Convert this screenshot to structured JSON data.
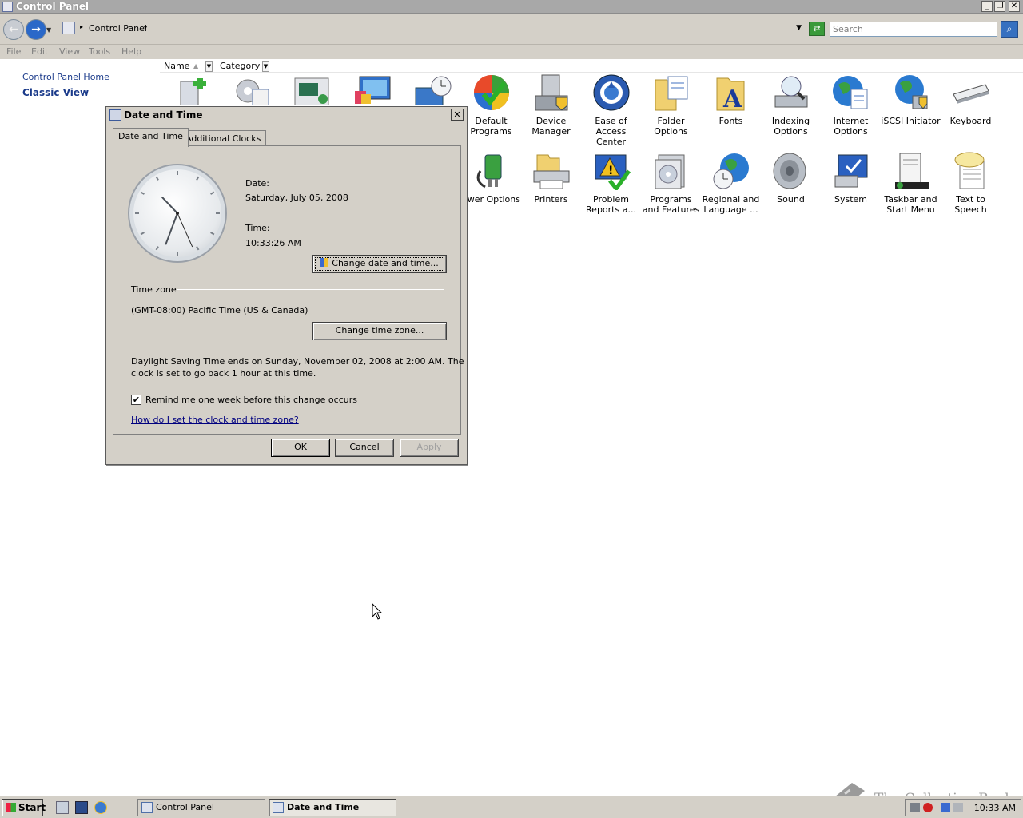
{
  "window": {
    "title": "Control Panel"
  },
  "address": {
    "path": "Control Panel",
    "search_placeholder": "Search"
  },
  "menu": [
    "File",
    "Edit",
    "View",
    "Tools",
    "Help"
  ],
  "left_pane": {
    "home_link": "Control Panel Home",
    "classic_view": "Classic View"
  },
  "columns": {
    "name": "Name",
    "category": "Category"
  },
  "items_row1": [
    {
      "label": "Default Programs",
      "icon": "default-programs-icon"
    },
    {
      "label": "Device Manager",
      "icon": "device-manager-icon"
    },
    {
      "label": "Ease of Access Center",
      "icon": "ease-of-access-icon"
    },
    {
      "label": "Folder Options",
      "icon": "folder-options-icon"
    },
    {
      "label": "Fonts",
      "icon": "fonts-icon"
    },
    {
      "label": "Indexing Options",
      "icon": "indexing-options-icon"
    },
    {
      "label": "Internet Options",
      "icon": "internet-options-icon"
    },
    {
      "label": "iSCSI Initiator",
      "icon": "iscsi-initiator-icon"
    },
    {
      "label": "Keyboard",
      "icon": "keyboard-icon"
    }
  ],
  "items_row2": [
    {
      "label": "ower Options",
      "icon": "power-options-icon"
    },
    {
      "label": "Printers",
      "icon": "printers-icon"
    },
    {
      "label": "Problem Reports a...",
      "icon": "problem-reports-icon"
    },
    {
      "label": "Programs and Features",
      "icon": "programs-features-icon"
    },
    {
      "label": "Regional and Language ...",
      "icon": "regional-language-icon"
    },
    {
      "label": "Sound",
      "icon": "sound-icon"
    },
    {
      "label": "System",
      "icon": "system-icon"
    },
    {
      "label": "Taskbar and Start Menu",
      "icon": "taskbar-start-menu-icon"
    },
    {
      "label": "Text to Speech",
      "icon": "text-to-speech-icon"
    }
  ],
  "dialog": {
    "title": "Date and Time",
    "tabs": [
      "Date and Time",
      "Additional Clocks"
    ],
    "date_label": "Date:",
    "date_value": "Saturday, July 05, 2008",
    "time_label": "Time:",
    "time_value": "10:33:26 AM",
    "clock": {
      "hour": 10,
      "minute": 33,
      "second": 26
    },
    "change_datetime_button": "Change date and time...",
    "timezone_heading": "Time zone",
    "timezone_value": "(GMT-08:00) Pacific Time (US & Canada)",
    "change_timezone_button": "Change time zone...",
    "dst_text_line1": "Daylight Saving Time ends on Sunday, November 02, 2008 at 2:00 AM. The",
    "dst_text_line2": "clock is set to go back 1 hour at this time.",
    "remind_checkbox_label": "Remind me one week before this change occurs",
    "remind_checked": true,
    "help_link": "How do I set the clock and time zone?",
    "ok": "OK",
    "cancel": "Cancel",
    "apply": "Apply"
  },
  "taskbar": {
    "start": "Start",
    "tasks": [
      "Control Panel",
      "Date and Time"
    ],
    "clock": "10:33 AM"
  },
  "watermark": "The Collection Book"
}
